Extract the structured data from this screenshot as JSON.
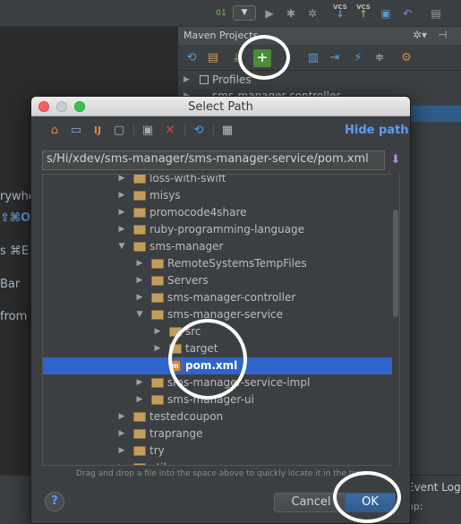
{
  "ide": {
    "editor_fragments": [
      "rywhe",
      "⇧⌘O",
      "s ⌘E",
      "Bar",
      "from"
    ],
    "maven": {
      "title": "Maven Projects",
      "tree": [
        {
          "label": "Profiles",
          "expandable": true
        },
        {
          "label": "sms-manager-controller",
          "expandable": true
        }
      ]
    },
    "bottom": {
      "event_log": "Event Log",
      "status_right": "op:"
    },
    "toolbar_vcs": [
      "VCS",
      "VCS"
    ]
  },
  "dialog": {
    "title": "Select Path",
    "hide_path_label": "Hide path",
    "path_value": "s/Hi/xdev/sms-manager/sms-manager-service/pom.xml",
    "hint": "Drag and drop a file into the space above to quickly locate it in the tree",
    "help_label": "?",
    "cancel_label": "Cancel",
    "ok_label": "OK",
    "tree": [
      {
        "label": "loss-with-swift",
        "depth": 0,
        "type": "folder",
        "arrow": "closed"
      },
      {
        "label": "misys",
        "depth": 0,
        "type": "folder",
        "arrow": "closed"
      },
      {
        "label": "promocode4share",
        "depth": 0,
        "type": "folder",
        "arrow": "closed"
      },
      {
        "label": "ruby-programming-language",
        "depth": 0,
        "type": "folder",
        "arrow": "closed"
      },
      {
        "label": "sms-manager",
        "depth": 0,
        "type": "folder",
        "arrow": "open"
      },
      {
        "label": "RemoteSystemsTempFiles",
        "depth": 1,
        "type": "folder",
        "arrow": "closed"
      },
      {
        "label": "Servers",
        "depth": 1,
        "type": "folder",
        "arrow": "closed"
      },
      {
        "label": "sms-manager-controller",
        "depth": 1,
        "type": "folder",
        "arrow": "closed"
      },
      {
        "label": "sms-manager-service",
        "depth": 1,
        "type": "folder",
        "arrow": "open"
      },
      {
        "label": "src",
        "depth": 2,
        "type": "folder",
        "arrow": "closed"
      },
      {
        "label": "target",
        "depth": 2,
        "type": "folder",
        "arrow": "closed"
      },
      {
        "label": "pom.xml",
        "depth": 2,
        "type": "file",
        "arrow": "none",
        "selected": true
      },
      {
        "label": "sms-manager-service-impl",
        "depth": 1,
        "type": "folder",
        "arrow": "closed"
      },
      {
        "label": "sms-manager-ui",
        "depth": 1,
        "type": "folder",
        "arrow": "closed"
      },
      {
        "label": "testedcoupon",
        "depth": 0,
        "type": "folder",
        "arrow": "closed"
      },
      {
        "label": "traprange",
        "depth": 0,
        "type": "folder",
        "arrow": "closed"
      },
      {
        "label": "try",
        "depth": 0,
        "type": "folder",
        "arrow": "closed"
      },
      {
        "label": "utils",
        "depth": 0,
        "type": "folder",
        "arrow": "closed"
      }
    ]
  },
  "colors": {
    "accent": "#589df6",
    "selection": "#2f65ca",
    "folder": "#c29d5e",
    "annotation": "#ffffff"
  }
}
